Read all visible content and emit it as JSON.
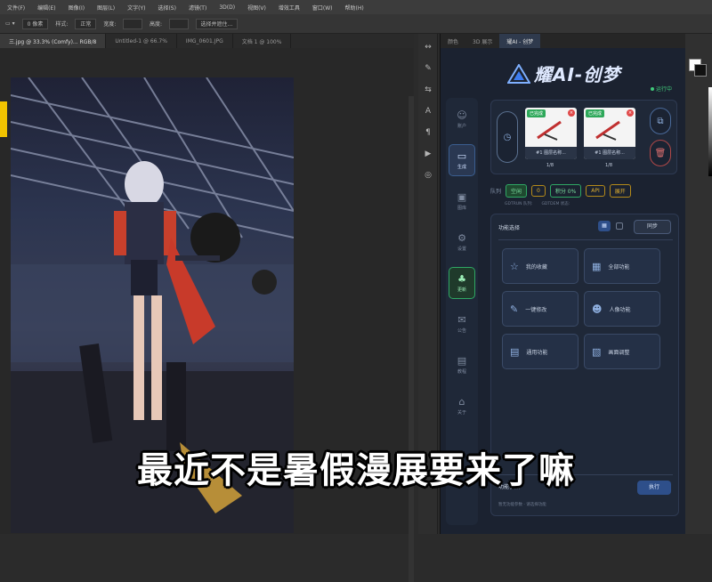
{
  "menubar": {
    "items": [
      "文件(F)",
      "编辑(E)",
      "图像(I)",
      "图层(L)",
      "文字(Y)",
      "选择(S)",
      "滤镜(T)",
      "3D(D)",
      "视图(V)",
      "增效工具",
      "窗口(W)",
      "帮助(H)"
    ]
  },
  "options": {
    "size_value": "0 像素",
    "style_label": "样式:",
    "style_value": "正常",
    "w_label": "宽度:",
    "h_label": "高度:",
    "mask_label": "选择并遮住..."
  },
  "doc_tabs": [
    {
      "label": "三.jpg @ 33.3% (Comfy)... RGB/8",
      "active": true
    },
    {
      "label": "Untitled-1 @ 66.7%",
      "active": false
    },
    {
      "label": "IMG_0601.JPG",
      "active": false
    },
    {
      "label": "文档 1 @ 100%",
      "active": false
    }
  ],
  "tools": [
    "↔",
    "✎",
    "⇆",
    "A",
    "¶",
    "▶",
    "◎"
  ],
  "plugin": {
    "tabs": [
      "颜色",
      "3D 展示",
      "耀AI - 创梦"
    ],
    "active_tab": 2,
    "logo_text": "耀AI-创梦",
    "online": "运行中",
    "nav": [
      {
        "icon": "☺",
        "label": "账户",
        "state": ""
      },
      {
        "icon": "▭",
        "label": "生成",
        "state": "on"
      },
      {
        "icon": "▣",
        "label": "图库",
        "state": ""
      },
      {
        "icon": "⚙",
        "label": "设置",
        "state": ""
      },
      {
        "icon": "♣",
        "label": "更新",
        "state": "green"
      },
      {
        "icon": "✉",
        "label": "公告",
        "state": ""
      },
      {
        "icon": "▤",
        "label": "教程",
        "state": ""
      },
      {
        "icon": "⌂",
        "label": "关于",
        "state": ""
      }
    ],
    "thumbs": [
      {
        "tag": "已完成",
        "caption": "#1 图层名称...",
        "sub": "1/8"
      },
      {
        "tag": "已完成",
        "caption": "#1 图层名称...",
        "sub": "1/8"
      }
    ],
    "status": {
      "left": "队列",
      "badge1": "空闲",
      "badge2": "0",
      "badge3": "积分 0%",
      "badge4": "API",
      "badge5": "展开"
    },
    "status_sub": [
      "GDTRUN 队列:",
      "GDTDEM 状态:"
    ],
    "func": {
      "title": "功能选择",
      "toggle": "▦",
      "sync": "同步",
      "buttons": [
        {
          "icon": "☆",
          "label": "我的收藏"
        },
        {
          "icon": "▦",
          "label": "全部功能"
        },
        {
          "icon": "✎",
          "label": "一键修改"
        },
        {
          "icon": "☻",
          "label": "人像功能"
        },
        {
          "icon": "▤",
          "label": "通用功能"
        },
        {
          "icon": "▧",
          "label": "画面调整"
        }
      ],
      "low_title": "功能参数",
      "low_sub": "暂无功能参数 · 请选择功能",
      "run": "执行"
    }
  },
  "subtitle": "最近不是暑假漫展要来了嘛"
}
